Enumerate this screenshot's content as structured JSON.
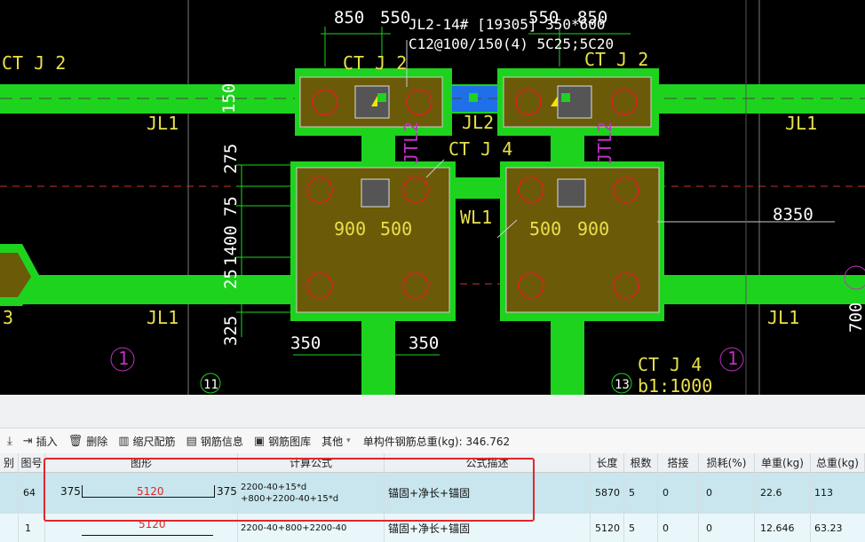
{
  "cad": {
    "top_dims": [
      "850",
      "550",
      "550",
      "850"
    ],
    "beam_tag_line1": "JL2-14# [19305] 350*600",
    "beam_tag_line2": "C12@100/150(4) 5C25;5C20",
    "ctj2_left": "CT J 2",
    "ctj2_mid1": "CT J 2",
    "ctj2_mid2": "CT J 2",
    "ctj4_label": "CT J 4",
    "ctj4_label2": "CT J 4",
    "cap_note": "b1:1000",
    "jl1": "JL1",
    "jl2": "JL2",
    "jl2_vertical": "JTL2",
    "wl1": "WL1",
    "dim_8350": "8350",
    "cap_dims": [
      "900",
      "500",
      "500",
      "900"
    ],
    "left_dims": [
      "150",
      "275",
      "75",
      "1400",
      "25",
      "325"
    ],
    "bottom_dims": [
      "350",
      "350"
    ],
    "right_dim": "700",
    "axis_11": "11",
    "axis_13": "13",
    "section_mark": "1",
    "left_partial": "3"
  },
  "toolbar": {
    "insert": "插入",
    "delete": "删除",
    "scale": "缩尺配筋",
    "info": "钢筋信息",
    "library": "钢筋图库",
    "other": "其他",
    "total_label": "单构件钢筋总重(kg): 346.762"
  },
  "table": {
    "headers": [
      "别",
      "图号",
      "图形",
      "计算公式",
      "公式描述",
      "长度",
      "根数",
      "搭接",
      "损耗(%)",
      "单重(kg)",
      "总重(kg)"
    ],
    "rows": [
      {
        "fig": "64",
        "shape_left": "375",
        "shape_mid": "5120",
        "shape_right": "375",
        "formula1": "2200-40+15*d",
        "formula2": "+800+2200-40+15*d",
        "desc": "锚固+净长+锚固",
        "length": "5870",
        "count": "5",
        "lap": "0",
        "loss": "0",
        "unit_wt": "22.6",
        "total_wt": "113"
      },
      {
        "fig": "1",
        "shape_mid": "5120",
        "formula1": "2200-40+800+2200-40",
        "desc": "锚固+净长+锚固",
        "length": "5120",
        "count": "5",
        "lap": "0",
        "loss": "0",
        "unit_wt": "12.646",
        "total_wt": "63.23"
      }
    ]
  }
}
